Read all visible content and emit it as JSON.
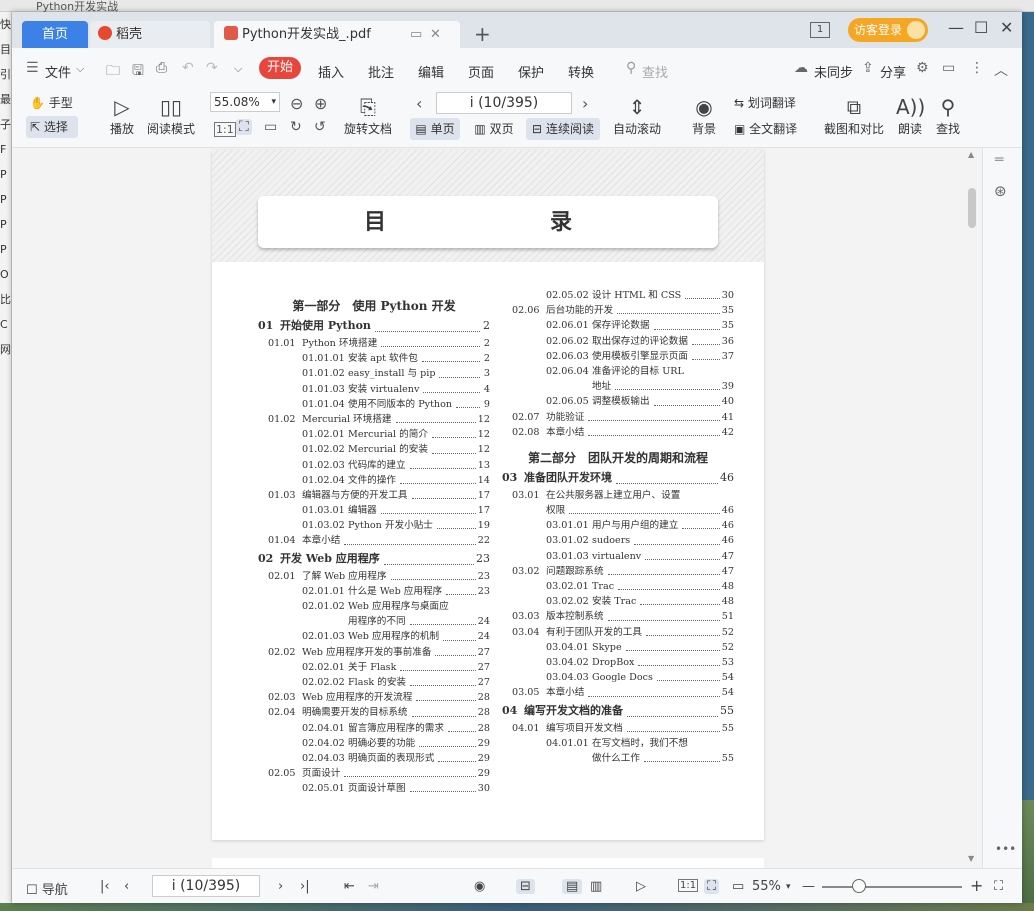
{
  "window": {
    "desktop_title": "Python开发实战",
    "tabs": {
      "home": "首页",
      "daoke": "稻壳",
      "pdf": "Python开发实战_.pdf"
    },
    "visitor_login": "访客登录"
  },
  "menu": {
    "file": "文件",
    "start": "开始",
    "insert": "插入",
    "annotate": "批注",
    "edit": "编辑",
    "page": "页面",
    "protect": "保护",
    "convert": "转换",
    "search_placeholder": "查找",
    "unsynced": "未同步",
    "share": "分享"
  },
  "toolbar": {
    "hand": "手型",
    "select": "选择",
    "play": "播放",
    "read_mode": "阅读模式",
    "zoom": "55.08%",
    "rotate_doc": "旋转文档",
    "page_indicator": "i (10/395)",
    "single_page": "单页",
    "double_page": "双页",
    "continuous": "连续阅读",
    "auto_scroll": "自动滚动",
    "background": "背景",
    "word_translate": "划词翻译",
    "full_translate": "全文翻译",
    "crop_compare": "截图和对比",
    "read_aloud": "朗读",
    "find": "查找"
  },
  "document": {
    "page_title": "目　　录",
    "left": [
      {
        "kind": "part",
        "text": "第一部分　使用 Python 开发"
      },
      {
        "kind": "chap",
        "num": "01",
        "text": "开始使用 Python",
        "page": "2"
      },
      {
        "kind": "l2",
        "num": "01.01",
        "text": "Python 环境搭建",
        "page": "2"
      },
      {
        "kind": "l3",
        "num": "01.01.01",
        "text": "安装 apt 软件包",
        "page": "2"
      },
      {
        "kind": "l3",
        "num": "01.01.02",
        "text": "easy_install 与 pip",
        "page": "3"
      },
      {
        "kind": "l3",
        "num": "01.01.03",
        "text": "安装 virtualenv",
        "page": "4"
      },
      {
        "kind": "l3",
        "num": "01.01.04",
        "text": "使用不同版本的 Python",
        "page": "9"
      },
      {
        "kind": "l2",
        "num": "01.02",
        "text": "Mercurial 环境搭建",
        "page": "12"
      },
      {
        "kind": "l3",
        "num": "01.02.01",
        "text": "Mercurial 的简介",
        "page": "12"
      },
      {
        "kind": "l3",
        "num": "01.02.02",
        "text": "Mercurial 的安装",
        "page": "12"
      },
      {
        "kind": "l3",
        "num": "01.02.03",
        "text": "代码库的建立",
        "page": "13"
      },
      {
        "kind": "l3",
        "num": "01.02.04",
        "text": "文件的操作",
        "page": "14"
      },
      {
        "kind": "l2",
        "num": "01.03",
        "text": "编辑器与方便的开发工具",
        "page": "17"
      },
      {
        "kind": "l3",
        "num": "01.03.01",
        "text": "编辑器",
        "page": "17"
      },
      {
        "kind": "l3",
        "num": "01.03.02",
        "text": "Python 开发小贴士",
        "page": "19"
      },
      {
        "kind": "l2",
        "num": "01.04",
        "text": "本章小结",
        "page": "22"
      },
      {
        "kind": "chap",
        "num": "02",
        "text": "开发 Web 应用程序",
        "page": "23"
      },
      {
        "kind": "l2",
        "num": "02.01",
        "text": "了解 Web 应用程序",
        "page": "23"
      },
      {
        "kind": "l3",
        "num": "02.01.01",
        "text": "什么是 Web 应用程序",
        "page": "23"
      },
      {
        "kind": "l3",
        "num": "02.01.02",
        "text": "Web 应用程序与桌面应",
        "page": ""
      },
      {
        "kind": "l3c",
        "num": "",
        "text": "用程序的不同",
        "page": "24"
      },
      {
        "kind": "l3",
        "num": "02.01.03",
        "text": "Web 应用程序的机制",
        "page": "24"
      },
      {
        "kind": "l2",
        "num": "02.02",
        "text": "Web 应用程序开发的事前准备",
        "page": "27"
      },
      {
        "kind": "l3",
        "num": "02.02.01",
        "text": "关于 Flask",
        "page": "27"
      },
      {
        "kind": "l3",
        "num": "02.02.02",
        "text": "Flask 的安装",
        "page": "27"
      },
      {
        "kind": "l2",
        "num": "02.03",
        "text": "Web 应用程序的开发流程",
        "page": "28"
      },
      {
        "kind": "l2",
        "num": "02.04",
        "text": "明确需要开发的目标系统",
        "page": "28"
      },
      {
        "kind": "l3",
        "num": "02.04.01",
        "text": "留言簿应用程序的需求",
        "page": "28"
      },
      {
        "kind": "l3",
        "num": "02.04.02",
        "text": "明确必要的功能",
        "page": "29"
      },
      {
        "kind": "l3",
        "num": "02.04.03",
        "text": "明确页面的表现形式",
        "page": "29"
      },
      {
        "kind": "l2",
        "num": "02.05",
        "text": "页面设计",
        "page": "29"
      },
      {
        "kind": "l3",
        "num": "02.05.01",
        "text": "页面设计草图",
        "page": "30"
      }
    ],
    "right": [
      {
        "kind": "l3",
        "num": "02.05.02",
        "text": "设计 HTML 和 CSS",
        "page": "30"
      },
      {
        "kind": "l2",
        "num": "02.06",
        "text": "后台功能的开发",
        "page": "35"
      },
      {
        "kind": "l3",
        "num": "02.06.01",
        "text": "保存评论数据",
        "page": "35"
      },
      {
        "kind": "l3",
        "num": "02.06.02",
        "text": "取出保存过的评论数据",
        "page": "36"
      },
      {
        "kind": "l3",
        "num": "02.06.03",
        "text": "使用模板引擎显示页面",
        "page": "37"
      },
      {
        "kind": "l3",
        "num": "02.06.04",
        "text": "准备评论的目标 URL",
        "page": ""
      },
      {
        "kind": "l3c",
        "num": "",
        "text": "地址",
        "page": "39"
      },
      {
        "kind": "l3",
        "num": "02.06.05",
        "text": "调整模板输出",
        "page": "40"
      },
      {
        "kind": "l2",
        "num": "02.07",
        "text": "功能验证",
        "page": "41"
      },
      {
        "kind": "l2",
        "num": "02.08",
        "text": "本章小结",
        "page": "42"
      },
      {
        "kind": "part",
        "text": "第二部分　团队开发的周期和流程"
      },
      {
        "kind": "chap",
        "num": "03",
        "text": "准备团队开发环境",
        "page": "46"
      },
      {
        "kind": "l2",
        "num": "03.01",
        "text": "在公共服务器上建立用户、设置",
        "page": ""
      },
      {
        "kind": "l2c",
        "num": "",
        "text": "权限",
        "page": "46"
      },
      {
        "kind": "l3",
        "num": "03.01.01",
        "text": "用户与用户组的建立",
        "page": "46"
      },
      {
        "kind": "l3",
        "num": "03.01.02",
        "text": "sudoers",
        "page": "46"
      },
      {
        "kind": "l3",
        "num": "03.01.03",
        "text": "virtualenv",
        "page": "47"
      },
      {
        "kind": "l2",
        "num": "03.02",
        "text": "问题跟踪系统",
        "page": "47"
      },
      {
        "kind": "l3",
        "num": "03.02.01",
        "text": "Trac",
        "page": "48"
      },
      {
        "kind": "l3",
        "num": "03.02.02",
        "text": "安装 Trac",
        "page": "48"
      },
      {
        "kind": "l2",
        "num": "03.03",
        "text": "版本控制系统",
        "page": "51"
      },
      {
        "kind": "l2",
        "num": "03.04",
        "text": "有利于团队开发的工具",
        "page": "52"
      },
      {
        "kind": "l3",
        "num": "03.04.01",
        "text": "Skype",
        "page": "52"
      },
      {
        "kind": "l3",
        "num": "03.04.02",
        "text": "DropBox",
        "page": "53"
      },
      {
        "kind": "l3",
        "num": "03.04.03",
        "text": "Google Docs",
        "page": "54"
      },
      {
        "kind": "l2",
        "num": "03.05",
        "text": "本章小结",
        "page": "54"
      },
      {
        "kind": "chap",
        "num": "04",
        "text": "编写开发文档的准备",
        "page": "55"
      },
      {
        "kind": "l2",
        "num": "04.01",
        "text": "编写项目开发文档",
        "page": "55"
      },
      {
        "kind": "l3",
        "num": "04.01.01",
        "text": "在写文档时，我们不想",
        "page": ""
      },
      {
        "kind": "l3c",
        "num": "",
        "text": "做什么工作",
        "page": "55"
      }
    ]
  },
  "statusbar": {
    "nav": "导航",
    "page_indicator": "i (10/395)",
    "zoom": "55%"
  }
}
